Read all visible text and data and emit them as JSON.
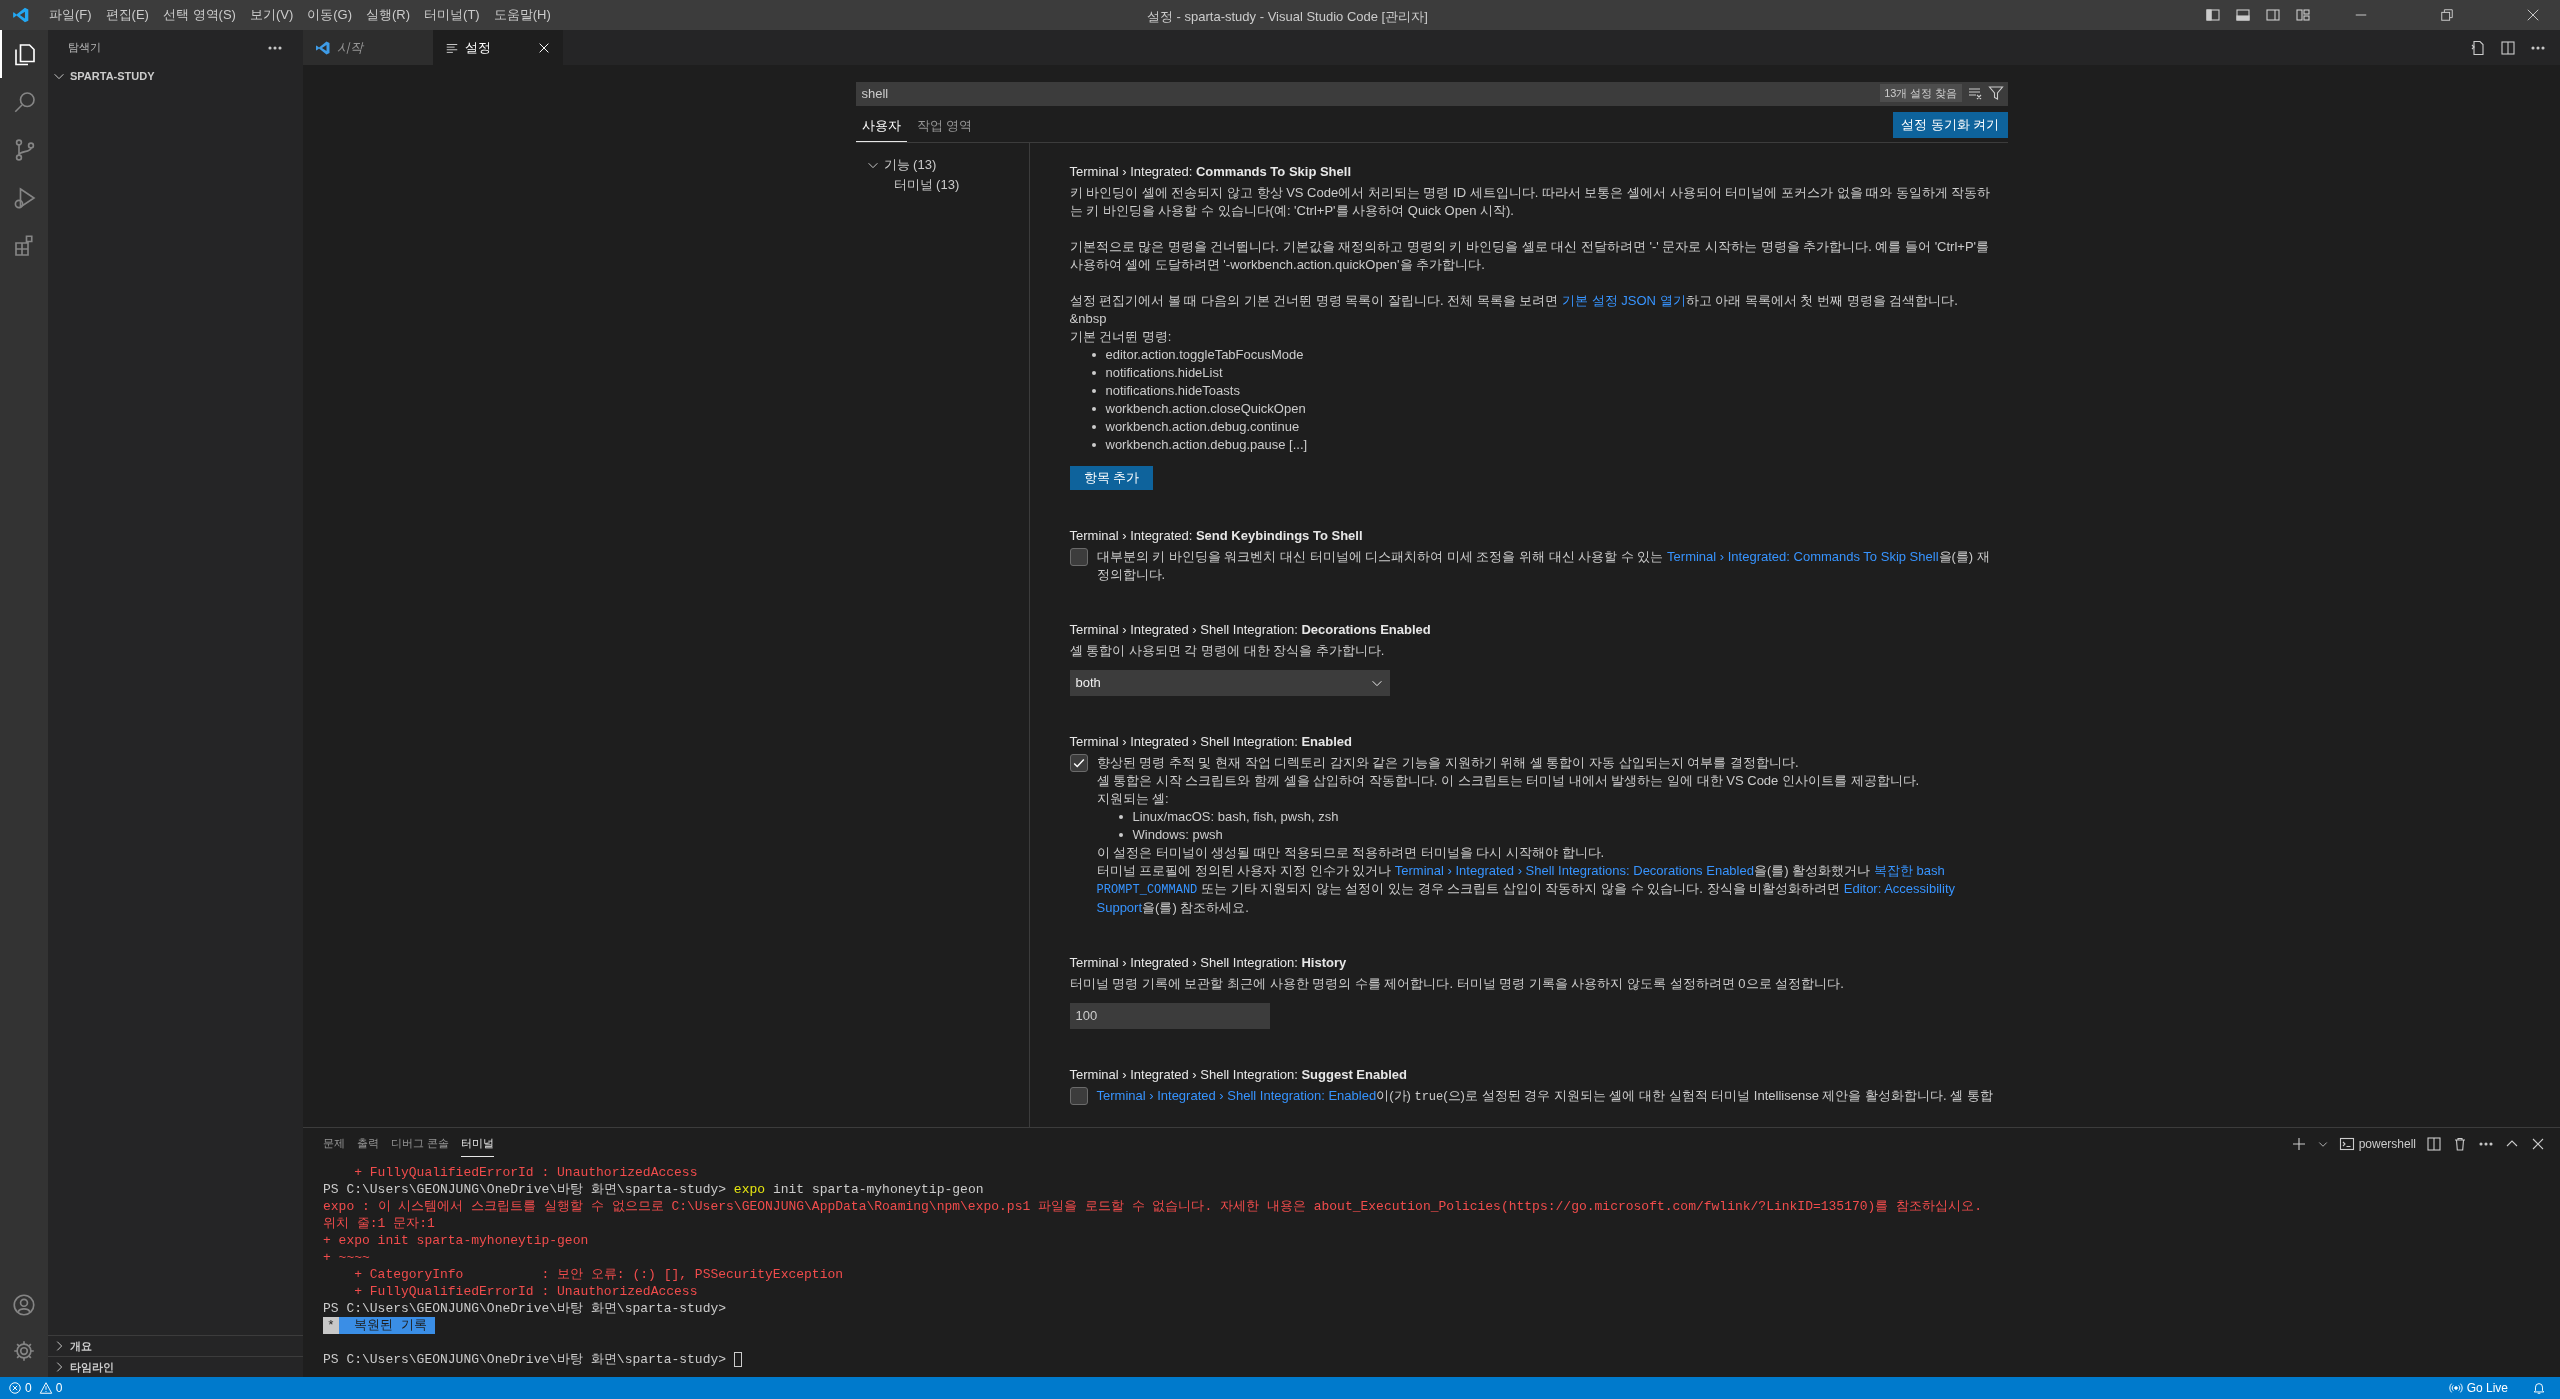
{
  "title_bar": {
    "menu": [
      "파일(F)",
      "편집(E)",
      "선택 영역(S)",
      "보기(V)",
      "이동(G)",
      "실행(R)",
      "터미널(T)",
      "도움말(H)"
    ],
    "title": "설정 - sparta-study - Visual Studio Code [관리자]"
  },
  "activity_bar": [
    {
      "kind": "explorer",
      "selected": true
    },
    {
      "kind": "search",
      "selected": false
    },
    {
      "kind": "source_control",
      "selected": false
    },
    {
      "kind": "run",
      "selected": false
    },
    {
      "kind": "extensions",
      "selected": false
    }
  ],
  "sidebar": {
    "title": "탐색기",
    "folder": {
      "label": "SPARTA-STUDY",
      "expanded": true
    },
    "sections": [
      {
        "label": "개요",
        "expanded": false
      },
      {
        "label": "타임라인",
        "expanded": false
      }
    ]
  },
  "editor_tabs": [
    {
      "label": "시작",
      "kind": "welcome",
      "selected": false
    },
    {
      "label": "설정",
      "kind": "settings",
      "selected": true
    }
  ],
  "settings": {
    "search": "shell",
    "result_count": "13개 설정 찾음",
    "scopes": [
      {
        "label": "사용자",
        "selected": true
      },
      {
        "label": "작업 영역",
        "selected": false
      }
    ],
    "sync_button": "설정 동기화 켜기",
    "toc": [
      {
        "label": "기능 (13)",
        "expanded": true,
        "children": [
          {
            "label": "터미널 (13)"
          }
        ]
      }
    ],
    "items": [
      {
        "kind": "list",
        "title": "Terminal › Integrated: **Commands To Skip Shell**",
        "description": [
          {
            "kind": "line",
            "segments": [
              {
                "text": "키 바인딩이 셸에 전송되지 않고 항상 VS Code에서 처리되는 명령 ID 세트입니다. 따라서 보통은 셸에서 사용되어 터미널에 포커스가 없을 때와 동일하게 작동하는 키 바인딩을 사용할 수 있습니다(예: 'Ctrl+P'를 사용하여 Quick Open 시작).",
                "kind": "plain"
              }
            ]
          },
          {
            "kind": "paragraph",
            "segments": [
              {
                "text": "기본적으로 많은 명령을 건너뜁니다. 기본값을 재정의하고 명령의 키 바인딩을 셸로 대신 전달하려면 '-' 문자로 시작하는 명령을 추가합니다. 예를 들어 'Ctrl+P'를 사용하여 셸에 도달하려면 '-workbench.action.quickOpen'을 추가합니다.",
                "kind": "plain"
              }
            ]
          },
          {
            "kind": "paragraph",
            "segments": [
              {
                "text": "설정 편집기에서 볼 때 다음의 기본 건너뛴 명령 목록이 잘립니다. 전체 목록을 보려면 ",
                "kind": "plain"
              },
              {
                "text": "기본 설정 JSON 열기",
                "kind": "link"
              },
              {
                "text": "하고 아래 목록에서 첫 번째 명령을 검색합니다.",
                "kind": "plain"
              }
            ]
          },
          {
            "kind": "line",
            "segments": [
              {
                "text": "&nbsp",
                "kind": "plain"
              }
            ]
          },
          {
            "kind": "line",
            "segments": [
              {
                "text": "기본 건너뛴 명령:",
                "kind": "plain"
              }
            ]
          },
          {
            "kind": "bullets",
            "items": [
              "editor.action.toggleTabFocusMode",
              "notifications.hideList",
              "notifications.hideToasts",
              "workbench.action.closeQuickOpen",
              "workbench.action.debug.continue",
              "workbench.action.debug.pause [...]"
            ]
          }
        ],
        "button": "항목 추가"
      },
      {
        "kind": "checkbox",
        "title": "Terminal › Integrated: **Send Keybindings To Shell**",
        "checked": false,
        "description": [
          {
            "kind": "line",
            "segments": [
              {
                "text": "대부분의 키 바인딩을 워크벤치 대신 터미널에 디스패치하여 미세 조정을 위해 대신 사용할 수 있는 ",
                "kind": "plain"
              },
              {
                "text": "Terminal › Integrated: Commands To Skip Shell",
                "kind": "link"
              },
              {
                "text": "을(를) 재정의합니다.",
                "kind": "plain"
              }
            ]
          }
        ]
      },
      {
        "kind": "select",
        "title": "Terminal › Integrated › Shell Integration: **Decorations Enabled**",
        "value": "both",
        "description": [
          {
            "kind": "line",
            "segments": [
              {
                "text": "셸 통합이 사용되면 각 명령에 대한 장식을 추가합니다.",
                "kind": "plain"
              }
            ]
          }
        ]
      },
      {
        "kind": "checkbox",
        "title": "Terminal › Integrated › Shell Integration: **Enabled**",
        "checked": true,
        "description": [
          {
            "kind": "line",
            "segments": [
              {
                "text": "향상된 명령 추적 및 현재 작업 디렉토리 감지와 같은 기능을 지원하기 위해 셸 통합이 자동 삽입되는지 여부를 결정합니다.",
                "kind": "plain"
              }
            ]
          },
          {
            "kind": "line",
            "segments": [
              {
                "text": "셸 통합은 시작 스크립트와 함께 셸을 삽입하여 작동합니다. 이 스크립트는 터미널 내에서 발생하는 일에 대한 VS Code 인사이트를 제공합니다.",
                "kind": "plain"
              }
            ]
          },
          {
            "kind": "line",
            "segments": [
              {
                "text": "지원되는 셸:",
                "kind": "plain"
              }
            ]
          },
          {
            "kind": "bullets",
            "items": [
              "Linux/macOS: bash, fish, pwsh, zsh",
              "Windows: pwsh"
            ]
          },
          {
            "kind": "line",
            "segments": [
              {
                "text": "이 설정은 터미널이 생성될 때만 적용되므로 적용하려면 터미널을 다시 시작해야 합니다.",
                "kind": "plain"
              }
            ]
          },
          {
            "kind": "line",
            "segments": [
              {
                "text": "터미널 프로필에 정의된 사용자 지정 인수가 있거나 ",
                "kind": "plain"
              },
              {
                "text": "Terminal › Integrated › Shell Integrations: Decorations Enabled",
                "kind": "link"
              },
              {
                "text": "을(를) 활성화했거나 ",
                "kind": "plain"
              },
              {
                "text": "복잡한 bash ",
                "kind": "link"
              },
              {
                "text": "PROMPT_COMMAND",
                "kind": "link_code"
              },
              {
                "text": " 또는 기타 지원되지 않는 설정이 있는 경우 스크립트 삽입이 작동하지 않을 수 있습니다. 장식을 비활성화하려면 ",
                "kind": "plain"
              },
              {
                "text": "Editor: Accessibility Support",
                "kind": "link"
              },
              {
                "text": "을(를) 참조하세요.",
                "kind": "plain"
              }
            ]
          }
        ]
      },
      {
        "kind": "number",
        "title": "Terminal › Integrated › Shell Integration: **History**",
        "value": "100",
        "description": [
          {
            "kind": "line",
            "segments": [
              {
                "text": "터미널 명령 기록에 보관할 최근에 사용한 명령의 수를 제어합니다. 터미널 명령 기록을 사용하지 않도록 설정하려면 0으로 설정합니다.",
                "kind": "plain"
              }
            ]
          }
        ]
      },
      {
        "kind": "checkbox",
        "title": "Terminal › Integrated › Shell Integration: **Suggest Enabled**",
        "checked": false,
        "description": [
          {
            "kind": "line",
            "segments": [
              {
                "text": "Terminal › Integrated › Shell Integration: Enabled",
                "kind": "link"
              },
              {
                "text": "이(가) ",
                "kind": "plain"
              },
              {
                "text": "true",
                "kind": "code"
              },
              {
                "text": "(으)로 설정된 경우 지원되는 셸에 대한 실험적 터미널 Intellisense 제안을 활성화합니다. 셸 통합",
                "kind": "plain"
              }
            ]
          }
        ]
      }
    ]
  },
  "panel": {
    "tabs": [
      {
        "label": "문제",
        "selected": false
      },
      {
        "label": "출력",
        "selected": false
      },
      {
        "label": "디버그 콘솔",
        "selected": false
      },
      {
        "label": "터미널",
        "selected": true
      }
    ],
    "profile": "powershell",
    "lines": [
      {
        "kind": "output",
        "segments": [
          {
            "text": "    + FullyQualifiedErrorId : UnauthorizedAccess",
            "kind": "error"
          }
        ]
      },
      {
        "kind": "output",
        "segments": [
          {
            "text": "PS C:\\Users\\GEONJUNG\\OneDrive\\바탕 화면\\sparta-study> ",
            "kind": "normal"
          },
          {
            "text": "expo",
            "kind": "command"
          },
          {
            "text": " init sparta-myhoneytip-geon",
            "kind": "normal"
          }
        ]
      },
      {
        "kind": "output",
        "segments": [
          {
            "text": "expo : 이 시스템에서 스크립트를 실행할 수 없으므로 C:\\Users\\GEONJUNG\\AppData\\Roaming\\npm\\expo.ps1 파일을 로드할 수 없습니다. 자세한 내용은 about_Execution_Policies(https://go.microsoft.com/fwlink/?LinkID=135170)를 참조하십시오.",
            "kind": "error"
          }
        ]
      },
      {
        "kind": "output",
        "segments": [
          {
            "text": "위치 줄:1 문자:1",
            "kind": "error"
          }
        ]
      },
      {
        "kind": "output",
        "segments": [
          {
            "text": "+ expo init sparta-myhoneytip-geon",
            "kind": "error"
          }
        ]
      },
      {
        "kind": "output",
        "segments": [
          {
            "text": "+ ~~~~",
            "kind": "error"
          }
        ]
      },
      {
        "kind": "output",
        "segments": [
          {
            "text": "    + CategoryInfo          : 보안 오류: (:) [], PSSecurityException",
            "kind": "error"
          }
        ]
      },
      {
        "kind": "output",
        "segments": [
          {
            "text": "    + FullyQualifiedErrorId : UnauthorizedAccess",
            "kind": "error"
          }
        ]
      },
      {
        "kind": "output",
        "segments": [
          {
            "text": "PS C:\\Users\\GEONJUNG\\OneDrive\\바탕 화면\\sparta-study>",
            "kind": "normal"
          }
        ]
      },
      {
        "kind": "restored",
        "marker": "*",
        "text": "  복원된 기록 "
      },
      {
        "kind": "blank"
      },
      {
        "kind": "prompt",
        "segments": [
          {
            "text": "PS C:\\Users\\GEONJUNG\\OneDrive\\바탕 화면\\sparta-study> ",
            "kind": "normal"
          }
        ]
      }
    ]
  },
  "status_bar": {
    "errors": "0",
    "warnings": "0",
    "go_live": "Go Live"
  }
}
